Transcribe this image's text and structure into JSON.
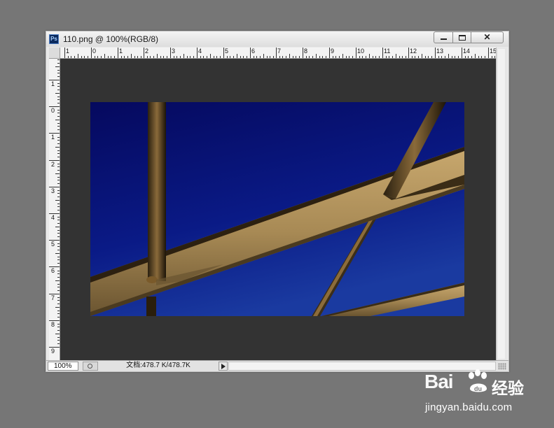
{
  "app": {
    "logo_text": "Ps",
    "document_title": "110.png @ 100%(RGB/8)",
    "close_glyph": "✕"
  },
  "rulers": {
    "top_labels": [
      "1",
      "0",
      "1",
      "2",
      "3",
      "4",
      "5",
      "6",
      "7",
      "8",
      "9",
      "10",
      "11",
      "12",
      "13",
      "14",
      "15"
    ],
    "left_labels": [
      "1",
      "0",
      "1",
      "2",
      "3",
      "4",
      "5",
      "6",
      "7",
      "8",
      "9"
    ]
  },
  "canvas": {
    "image_description_icon": "photo-bridge-arch",
    "sky_color": "#0a1a7a",
    "beam_color": "#a88a55"
  },
  "status": {
    "zoom": "100%",
    "doc_info": "文档:478.7 K/478.7K"
  },
  "watermark": {
    "brand_left": "Bai",
    "brand_right": "经验",
    "url": "jingyan.baidu.com"
  }
}
